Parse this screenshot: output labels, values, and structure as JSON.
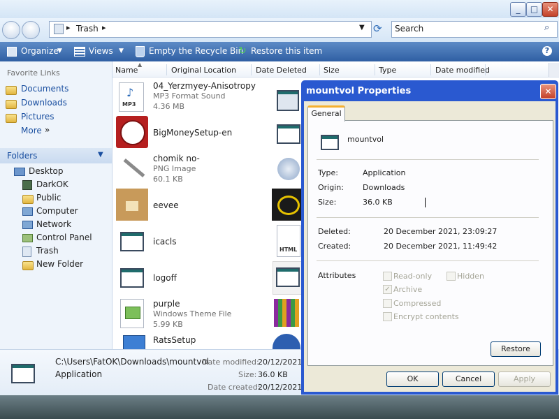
{
  "window": {
    "buttons": {
      "minimize": "_",
      "maximize": "□",
      "close": "✕"
    }
  },
  "address": {
    "breadcrumb": "Trash",
    "search_placeholder": "Search"
  },
  "toolbar": {
    "organize": "Organize",
    "views": "Views",
    "empty_recycle_bin": "Empty the Recycle Bin",
    "restore_item": "Restore this item"
  },
  "leftpane": {
    "favorite_links_header": "Favorite Links",
    "favorites": [
      "Documents",
      "Downloads",
      "Pictures"
    ],
    "more": "More",
    "folders_header": "Folders",
    "tree": [
      "Desktop",
      "DarkOK",
      "Public",
      "Computer",
      "Network",
      "Control Panel",
      "Trash",
      "New Folder"
    ]
  },
  "columns": [
    "Name",
    "Original Location",
    "Date Deleted",
    "Size",
    "Type",
    "Date modified"
  ],
  "files": [
    {
      "name": "04_Yerzmyey-Anisotropy",
      "type": "MP3 Format Sound",
      "size": "4.36 MB",
      "icon": "mp3-icon"
    },
    {
      "name": "BigMoneySetup-en",
      "icon": "bigmoney-icon"
    },
    {
      "name": "chomik no-",
      "type": "PNG Image",
      "size": "60.1 KB",
      "icon": "image-icon"
    },
    {
      "name": "eevee",
      "icon": "eevee-icon"
    },
    {
      "name": "icacls",
      "icon": "application-icon"
    },
    {
      "name": "logoff",
      "icon": "application-icon"
    },
    {
      "name": "purple",
      "type": "Windows Theme File",
      "size": "5.99 KB",
      "icon": "theme-icon"
    },
    {
      "name": "RatsSetup",
      "icon": "setup-icon"
    }
  ],
  "details": {
    "path": "C:\\Users\\FatOK\\Downloads\\mountvol",
    "type": "Application",
    "date_modified_label": "Date modified:",
    "date_modified": "20/12/2021",
    "size_label": "Size:",
    "size": "36.0 KB",
    "date_created_label": "Date created:",
    "date_created": "20/12/2021"
  },
  "dialog": {
    "title": "mountvol Properties",
    "tab": "General",
    "filename": "mountvol",
    "type_label": "Type:",
    "type_value": "Application",
    "origin_label": "Origin:",
    "origin_value": "Downloads",
    "size_label": "Size:",
    "size_value": "36.0 KB",
    "deleted_label": "Deleted:",
    "deleted_value": "20 December 2021, 23:09:27",
    "created_label": "Created:",
    "created_value": "20 December 2021, 11:49:42",
    "attributes_label": "Attributes",
    "attr_readonly": "Read-only",
    "attr_hidden": "Hidden",
    "attr_archive": "Archive",
    "attr_compressed": "Compressed",
    "attr_encrypt": "Encrypt contents",
    "restore": "Restore",
    "ok": "OK",
    "cancel": "Cancel",
    "apply": "Apply"
  }
}
